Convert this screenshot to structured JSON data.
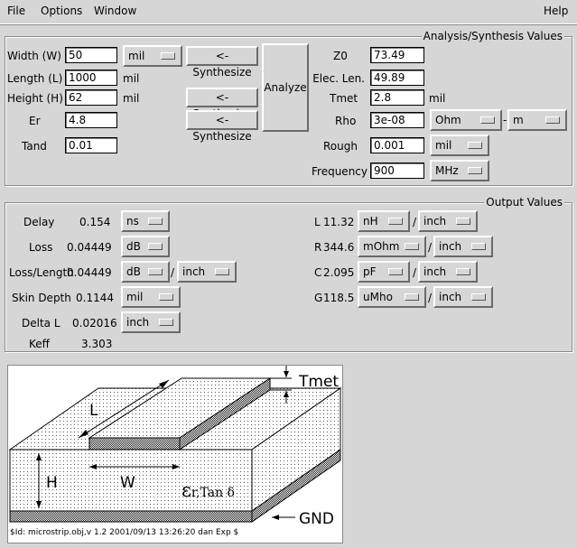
{
  "menubar": {
    "file": "File",
    "options": "Options",
    "window": "Window",
    "help": "Help"
  },
  "analysis": {
    "legend": "Analysis/Synthesis Values",
    "width": {
      "label": "Width (W)",
      "value": "50",
      "unit": "mil"
    },
    "length": {
      "label": "Length (L)",
      "value": "1000",
      "unit": "mil"
    },
    "height": {
      "label": "Height (H)",
      "value": "62",
      "unit": "mil"
    },
    "er": {
      "label": "Er",
      "value": "4.8"
    },
    "tand": {
      "label": "Tand",
      "value": "0.01"
    },
    "synth_label": "<-Synthesize",
    "analyze_label": "Analyze",
    "z0": {
      "label": "Z0",
      "value": "73.49"
    },
    "elec_len": {
      "label": "Elec. Len.",
      "value": "49.89"
    },
    "tmet": {
      "label": "Tmet",
      "value": "2.8",
      "unit": "mil"
    },
    "rho": {
      "label": "Rho",
      "value": "3e-08",
      "unit1": "Ohm",
      "sep": "-",
      "unit2": "m"
    },
    "rough": {
      "label": "Rough",
      "value": "0.001",
      "unit": "mil"
    },
    "frequency": {
      "label": "Frequency",
      "value": "900",
      "unit": "MHz"
    }
  },
  "output": {
    "legend": "Output Values",
    "delay": {
      "label": "Delay",
      "value": "0.154",
      "unit": "ns"
    },
    "loss": {
      "label": "Loss",
      "value": "0.04449",
      "unit": "dB"
    },
    "loss_length": {
      "label": "Loss/Length",
      "value": "0.04449",
      "unit": "dB",
      "sep": "/",
      "per": "inch"
    },
    "skin_depth": {
      "label": "Skin Depth",
      "value": "0.1144",
      "unit": "mil"
    },
    "delta_l": {
      "label": "Delta L",
      "value": "0.02016",
      "unit": "inch"
    },
    "keff": {
      "label": "Keff",
      "value": "3.303"
    },
    "l": {
      "label": "L",
      "value": "11.32",
      "unit": "nH",
      "sep": "/",
      "per": "inch"
    },
    "r": {
      "label": "R",
      "value": "344.6",
      "unit": "mOhm",
      "sep": "/",
      "per": "inch"
    },
    "c": {
      "label": "C",
      "value": "2.095",
      "unit": "pF",
      "sep": "/",
      "per": "inch"
    },
    "g": {
      "label": "G",
      "value": "118.5",
      "unit": "uMho",
      "sep": "/",
      "per": "inch"
    }
  },
  "figure": {
    "tmet": "Tmet",
    "l": "L",
    "h": "H",
    "w": "W",
    "gnd": "GND",
    "eps": "ε",
    "eps_sub": "r,Tan δ",
    "caption": "$Id: microstrip.obj,v 1.2 2001/09/13 13:26:20 dan Exp $"
  }
}
